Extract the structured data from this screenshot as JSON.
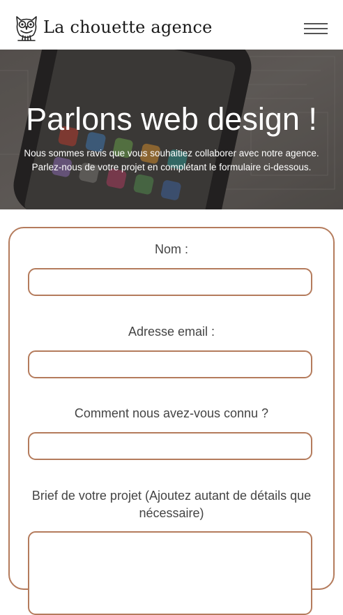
{
  "header": {
    "brand": "La chouette agence",
    "logo_icon": "owl-icon",
    "menu_icon": "hamburger-menu-icon"
  },
  "hero": {
    "title": "Parlons web design !",
    "subtitle_line1": "Nous sommes ravis que vous souhaitiez collaborer avec notre agence.",
    "subtitle_line2": "Parlez-nous de votre projet en complétant le formulaire ci-dessous."
  },
  "form": {
    "name_label": "Nom :",
    "name_value": "",
    "email_label": "Adresse email :",
    "email_value": "",
    "source_label": "Comment nous avez-vous connu ?",
    "source_value": "",
    "brief_label_line1": "Brief de votre projet (Ajoutez autant de détails que",
    "brief_label_line2": "nécessaire)",
    "brief_value": ""
  },
  "colors": {
    "accent": "#b47b5c",
    "text": "#444444",
    "hero_overlay": "#5e5a57"
  }
}
